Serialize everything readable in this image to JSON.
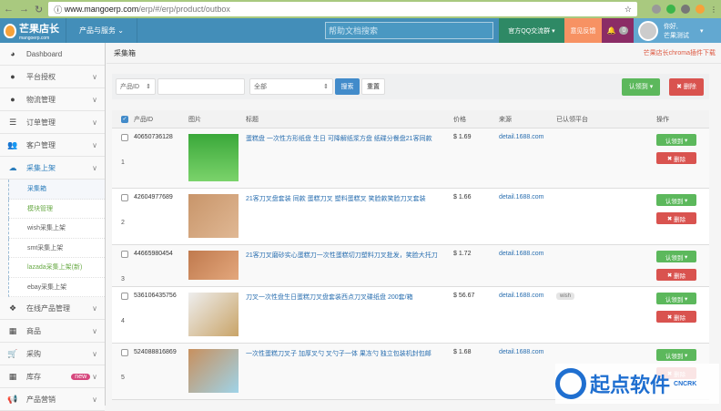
{
  "browser": {
    "url_host": "www.mangoerp.com",
    "url_path": "/erp/#/erp/product/outbox"
  },
  "header": {
    "logo": "芒果店长",
    "logo_sub": "mangoerp.com",
    "menu": "产品与服务",
    "search_placeholder": "帮助文档搜索",
    "qq": "官方QQ交流群",
    "feedback": "意见反馈",
    "notifications": "0",
    "greeting": "你好,",
    "username": "芒果测试"
  },
  "sidebar": {
    "items": [
      {
        "label": "Dashboard",
        "icon": "tachometer"
      },
      {
        "label": "平台授权",
        "icon": "globe"
      },
      {
        "label": "物流管理",
        "icon": "globe"
      },
      {
        "label": "订单管理",
        "icon": "list"
      },
      {
        "label": "客户管理",
        "icon": "users"
      },
      {
        "label": "采集上架",
        "icon": "cloud-upload"
      }
    ],
    "subitems": [
      "采集箱",
      "模块管理",
      "wish采集上架",
      "smt采集上架",
      "lazada采集上架(新)",
      "ebay采集上架"
    ],
    "items2": [
      {
        "label": "在线产品管理",
        "icon": "cubes"
      },
      {
        "label": "商品",
        "icon": "th"
      },
      {
        "label": "采购",
        "icon": "cart"
      },
      {
        "label": "库存",
        "icon": "th",
        "badge": "new"
      },
      {
        "label": "产品营销",
        "icon": "bullhorn"
      }
    ]
  },
  "page": {
    "title": "采集箱",
    "plugin_link": "芒果店长chroma插件下载"
  },
  "filter": {
    "field": "产品ID",
    "value": "",
    "status": "全部",
    "search": "搜索",
    "reset": "重置",
    "claim": "认领到",
    "delete": "删除"
  },
  "table": {
    "headers": [
      "产品ID",
      "图片",
      "标题",
      "价格",
      "来源",
      "已认领平台",
      "操作"
    ],
    "rows": [
      {
        "index": "1",
        "id": "40650736128",
        "title": "蛋糕盘 一次性方形纸盘 生日 可降解纸浆方盘 纸碟分餐盘21客同款",
        "price": "$ 1.69",
        "source": "detail.1688.com",
        "platform": ""
      },
      {
        "index": "2",
        "id": "42604977689",
        "title": "21客刀叉盘套装 同款 蛋糕刀叉 塑料蛋糕叉 笑脸款笑脸刀叉套装",
        "price": "$ 1.66",
        "source": "detail.1688.com",
        "platform": ""
      },
      {
        "index": "3",
        "id": "44665980454",
        "title": "21客刀叉磨砂实心蛋糕刀一次性蛋糕切刀塑料刀叉批发，笑脸大托刀",
        "price": "$ 1.72",
        "source": "detail.1688.com",
        "platform": ""
      },
      {
        "index": "4",
        "id": "536106435756",
        "title": "刀叉一次性盘生日蛋糕刀叉盘套装西点刀叉碟纸盘 200套/箱",
        "price": "$ 56.67",
        "source": "detail.1688.com",
        "platform": "wish"
      },
      {
        "index": "5",
        "id": "524088816869",
        "title": "一次性蛋糕刀叉子 加厚叉勺 叉勺子一体 果冻勺 独立包装机封包邮",
        "price": "$ 1.68",
        "source": "detail.1688.com",
        "platform": ""
      }
    ],
    "claim": "认领到",
    "delete": "删除"
  },
  "watermark": {
    "text": "起点软件",
    "sub": "CNCRK"
  },
  "colors": {
    "header": "#438eb9",
    "qq": "#2e8965",
    "feedback": "#f79263",
    "bell": "#8b2c66",
    "green": "#5cb85c",
    "red": "#d9534f"
  }
}
